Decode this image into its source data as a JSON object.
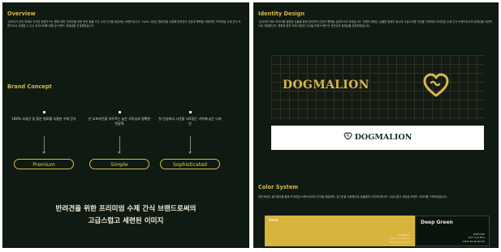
{
  "colors": {
    "panel_bg": "#0f1a12",
    "gold": "#d7b74a",
    "deep_green": "#0b130d",
    "text": "#e9e1c7"
  },
  "left": {
    "overview": {
      "title": "Overview",
      "text": "'강아지가 만의 미래로 간식만 맞벌가구는 함께 미래, 반려견을 위한 편안 동물 가진 수제 간식을 제공하는 브랜드입니다. 100% 국내산 원료만을 사용해 반려견의 건강과 행복을 지향하며, 프리미엄 수제 간식 브랜드로서 신뢰할 수 있는 로지서브를 위해 본 브랜드 정체성을 전개해왔습니다."
    },
    "brand_concept": {
      "title": "Brand Concept",
      "items": [
        {
          "desc": "100% 국내산 및 좋은 원료를 사용한 수제 간식",
          "label": "Premium"
        },
        {
          "desc": "온 오프라인을 아우르는 높은 가독성과 명확한 전달력",
          "label": "Simple"
        },
        {
          "desc": "첫 인상에서 시선을 사로잡는 기억에 남는 디자인",
          "label": "Sophisticated"
        }
      ]
    },
    "tagline": {
      "line1": "반려견을 위한 프리미엄 수제 간식 브랜드로써의",
      "line2": "고급스럽고 세련된 이미지"
    }
  },
  "right": {
    "identity": {
      "title": "Identity Design",
      "text": "'강아지의 하트 모티브를 결합한 심볼을 통해 반려견의 건강과 행복을 상징하고자 하였습니다. 전체적 형태는 심플한 형태이 동시에 고급스러운 라인을 구현하여 프리미엄 수제 간식 브랜드로서의 정체성을 직관적으로 전달합니다. 명확한 원칙 하에 세련된 인상을 전해 브랜드의 전문성과 정체성을 표현하였습니다."
    },
    "logo": {
      "wordmark": "DOGMALION"
    },
    "color_system": {
      "title": "Color System",
      "text": "메인색상인 골드컬러를 통해 프리미엄 브랜드로써의 인식을 확립하며, 딥그린을 사용함으로 동물에게 자연적이면서도 고급스럽고 세련된 브랜드 이미지를 구축하였습니다.",
      "swatches": [
        {
          "name": "Gold",
          "codes": [
            "#D9B43C",
            "RGB 217 180 60",
            "CMYK 15 25 85 0"
          ]
        },
        {
          "name": "Deep Green",
          "codes": [
            "#0B130D",
            "R11 G19 B13",
            "CMYK 80 60 80 85"
          ]
        }
      ]
    }
  }
}
